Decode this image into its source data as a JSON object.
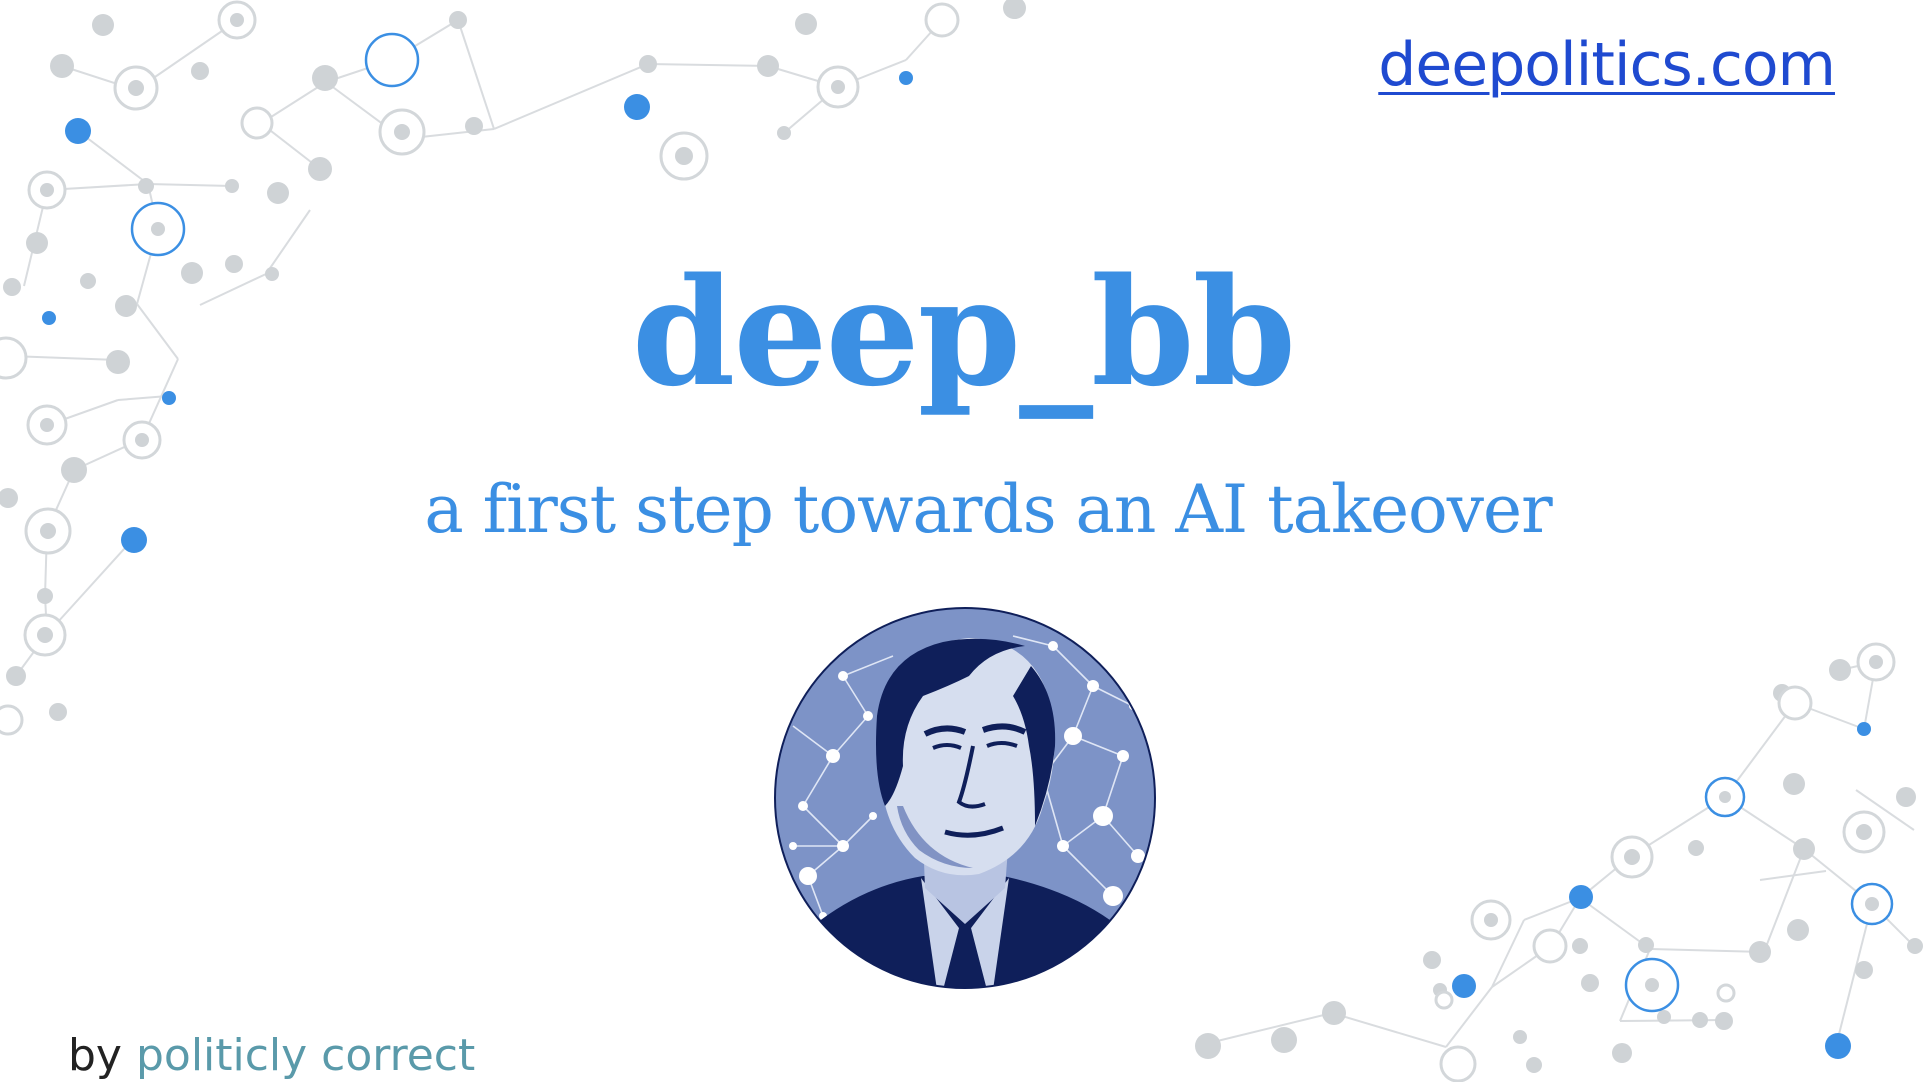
{
  "slide": {
    "site_link": "deepolitics.com",
    "title": "deep_bb",
    "subtitle": "a first step towards an AI takeover",
    "byline_prefix": "by",
    "byline_org": "politicly correct",
    "portrait_alt": "stylized portrait over network pattern"
  },
  "colors": {
    "accent": "#3b8fe3",
    "link": "#1f4ad0",
    "byline_org": "#5a9aaa",
    "node_gray": "#cfd3d6",
    "node_blue": "#3b8fe3",
    "portrait_bg": "#7d93c7",
    "portrait_dark": "#0f1f5a"
  },
  "icons": {
    "background": "network-pattern",
    "portrait": "portrait-medallion"
  }
}
